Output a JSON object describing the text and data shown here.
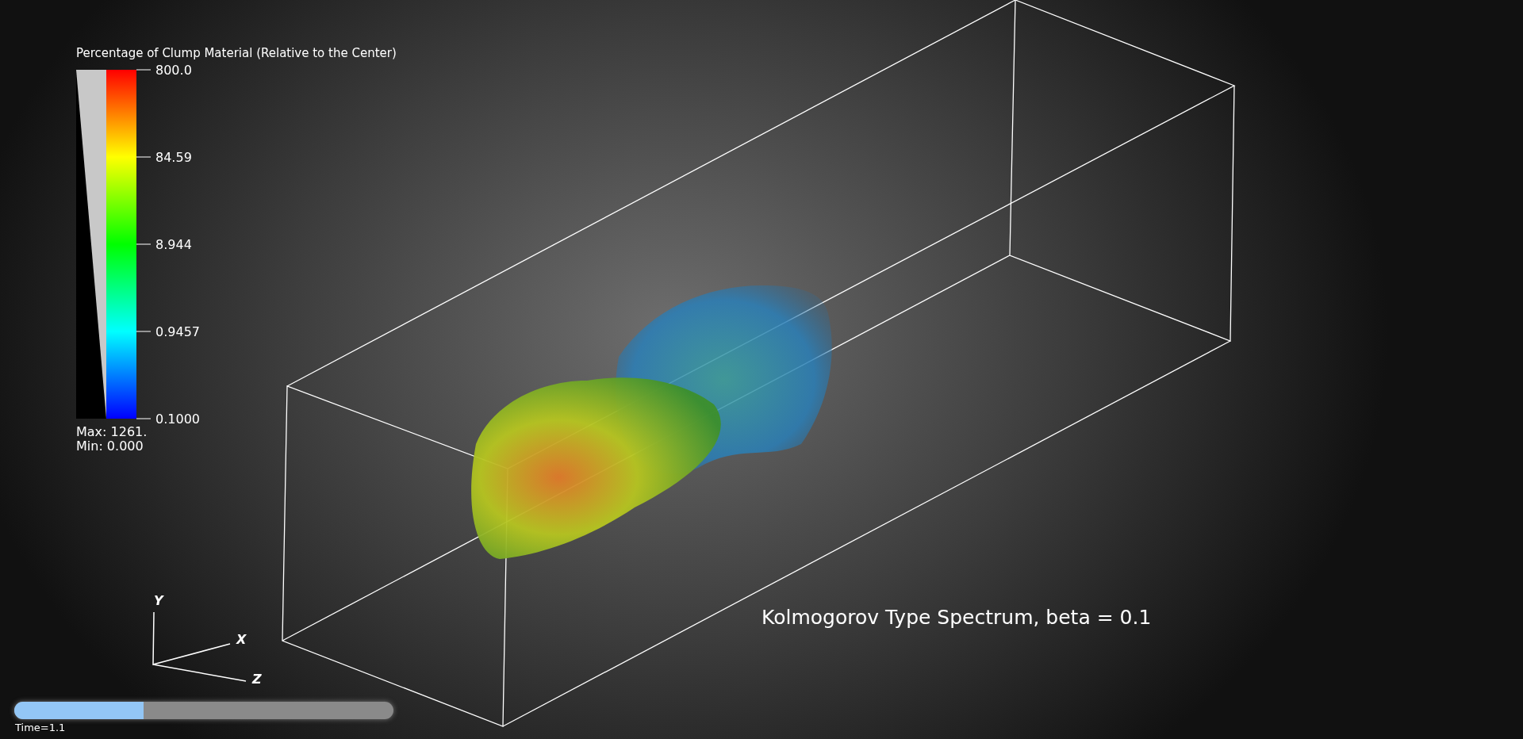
{
  "legend": {
    "title": "Percentage of Clump Material (Relative to the Center)",
    "ticks": [
      "800.0",
      "84.59",
      "8.944",
      "0.9457",
      "0.1000"
    ],
    "max": "Max:  1261.",
    "min": "Min:  0.000"
  },
  "axes": {
    "y": "Y",
    "x": "X",
    "z": "Z"
  },
  "annotation": "Kolmogorov Type Spectrum, beta = 0.1",
  "time": {
    "level": 0.34,
    "label": "Time=1.1"
  }
}
